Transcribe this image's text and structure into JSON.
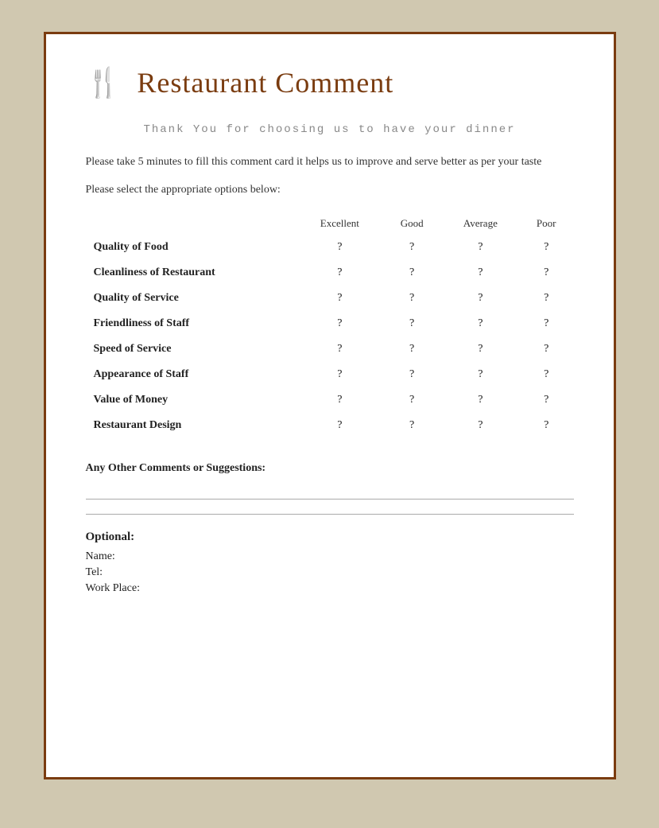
{
  "header": {
    "icon": "🍴",
    "title": "Restaurant Comment"
  },
  "subtitle": "Thank You for choosing us to have your dinner",
  "description": "Please take 5 minutes to fill this comment card it helps us to improve and serve better as per your taste",
  "instruction": "Please select the appropriate options below:",
  "table": {
    "columns": [
      "",
      "Excellent",
      "Good",
      "Average",
      "Poor"
    ],
    "rows": [
      {
        "label": "Quality of Food",
        "values": [
          "?",
          "?",
          "?",
          "?"
        ]
      },
      {
        "label": "Cleanliness of Restaurant",
        "values": [
          "?",
          "?",
          "?",
          "?"
        ]
      },
      {
        "label": "Quality of Service",
        "values": [
          "?",
          "?",
          "?",
          "?"
        ]
      },
      {
        "label": "Friendliness of Staff",
        "values": [
          "?",
          "?",
          "?",
          "?"
        ]
      },
      {
        "label": "Speed of Service",
        "values": [
          "?",
          "?",
          "?",
          "?"
        ]
      },
      {
        "label": "Appearance of Staff",
        "values": [
          "?",
          "?",
          "?",
          "?"
        ]
      },
      {
        "label": "Value of Money",
        "values": [
          "?",
          "?",
          "?",
          "?"
        ]
      },
      {
        "label": "Restaurant Design",
        "values": [
          "?",
          "?",
          "?",
          "?"
        ]
      }
    ]
  },
  "comments": {
    "label": "Any Other Comments or Suggestions:"
  },
  "optional": {
    "title": "Optional:",
    "fields": [
      "Name:",
      "Tel:",
      "Work Place:"
    ]
  }
}
